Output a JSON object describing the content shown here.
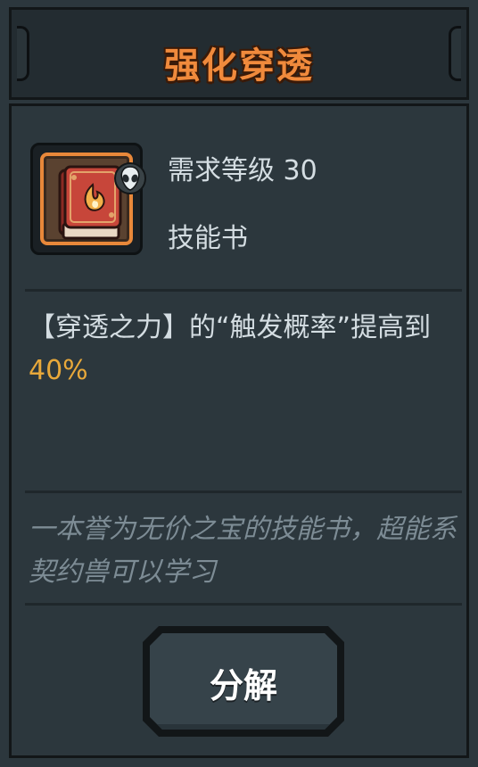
{
  "title": "强化穿透",
  "item": {
    "level_text": "需求等级 30",
    "type_text": "技能书",
    "icon": "skill-book-icon"
  },
  "description": {
    "prefix": "【穿透之力】的“触发概率”提高到",
    "highlight": "40%"
  },
  "flavor": "一本誉为无价之宝的技能书，超能系契约兽可以学习",
  "button": {
    "label": "分解"
  },
  "colors": {
    "title": "#f08a3c",
    "highlight": "#e8a83a",
    "frame_orange": "#e8883a"
  }
}
